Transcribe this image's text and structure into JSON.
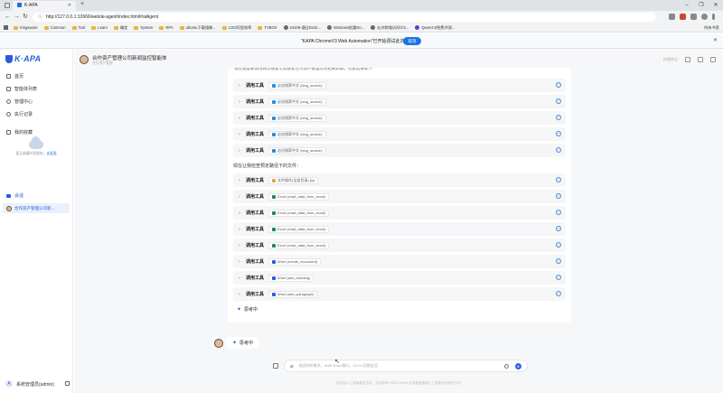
{
  "browser": {
    "tab_title": "K-APA",
    "url": "http://127.0.0.1:12666/web/ai-agent/index.html#/aiAgent",
    "bookmarks": [
      "Kingsware",
      "Common",
      "Tool",
      "Learn",
      "确定",
      "System",
      "RPA",
      "ubuntu下载镜像...",
      "LOG阿里效率",
      "TVBOX",
      "24108-通过Dock...",
      "Windows批量Do...",
      "允许跨域访问Chr...",
      "Qwen3.5免费评测..."
    ],
    "all_bookmarks": "所有书签",
    "infobar_message": "\"KAPA ChromeV3 Web Automation\"已开始调试此浏览器",
    "infobar_cancel": "取消"
  },
  "sidebar": {
    "logo": "K·APA",
    "items": [
      {
        "label": "首页",
        "icon": "home-icon"
      },
      {
        "label": "智能体列表",
        "icon": "grid-icon"
      },
      {
        "label": "管理中心",
        "icon": "gear-icon"
      },
      {
        "label": "执行记录",
        "icon": "clock-icon"
      },
      {
        "label": "我的收藏",
        "icon": "star-icon"
      }
    ],
    "favorites_empty_text": "暂无收藏的智能体，",
    "favorites_empty_link": "去逛逛",
    "chat_section": "会话",
    "chat_entry": "合作资产管理公司新...",
    "user_initial": "A",
    "user_name": "系统管理员(admin)"
  },
  "header": {
    "title": "合作资产管理公司新闻监控智能体",
    "subtitle": "合作资产管理",
    "right_text": "快速转让"
  },
  "conversation": {
    "cut_text": "现在我需要调用网页搜索工具搜索合作资产管理公司相关新闻，检索结果如下",
    "search_tools": [
      {
        "label": "调用工具",
        "tag": "必应搜索中文 (bing_search)"
      },
      {
        "label": "调用工具",
        "tag": "必应搜索中文 (bing_search)"
      },
      {
        "label": "调用工具",
        "tag": "必应搜索中文 (bing_search)"
      },
      {
        "label": "调用工具",
        "tag": "必应搜索中文 (bing_search)"
      },
      {
        "label": "调用工具",
        "tag": "必应搜索中文 (bing_search)"
      }
    ],
    "para": "现在让我检查预定路径下的文件：",
    "file_tools": [
      {
        "label": "调用工具",
        "tag": "文件操作(全部目录) (ls)",
        "color": "#e8a23a"
      },
      {
        "label": "调用工具",
        "tag": "Excel (read_data_from_excel)",
        "color": "#1f8a4c"
      },
      {
        "label": "调用工具",
        "tag": "Excel (read_data_from_excel)",
        "color": "#1f8a4c"
      },
      {
        "label": "调用工具",
        "tag": "Excel (read_data_from_excel)",
        "color": "#1f8a4c"
      },
      {
        "label": "调用工具",
        "tag": "Excel (read_data_from_excel)",
        "color": "#1f8a4c"
      },
      {
        "label": "调用工具",
        "tag": "Word (create_document)",
        "color": "#2a5bd7"
      },
      {
        "label": "调用工具",
        "tag": "Word (add_heading)",
        "color": "#2a5bd7"
      },
      {
        "label": "调用工具",
        "tag": "Word (add_paragraph)",
        "color": "#2a5bd7"
      }
    ],
    "thinking": "思考中",
    "bubble_thinking": "思考中"
  },
  "input": {
    "placeholder": "描述你的需求，Shift+Enter换行，Ctrl+K切换会话"
  },
  "footer": "内容由人工智能模型生成，仅供参考 ©2025 KAPA 北京数据金融人工智能应用研究公司"
}
